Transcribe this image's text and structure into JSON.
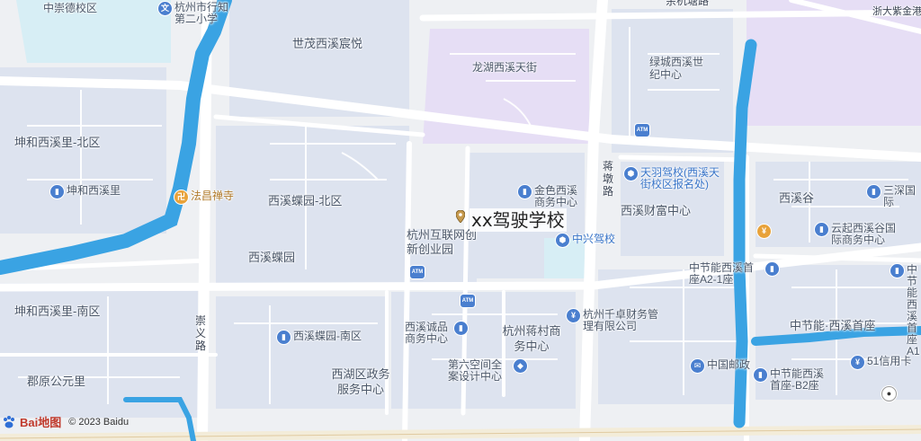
{
  "map": {
    "colors": {
      "land": "#eef0f3",
      "block": "#e2e8f2",
      "residential": "#dde3ef",
      "campus": "#e6def5",
      "water": "#3aa3e3",
      "road": "#ffffff",
      "arterial": "#f3ecd9",
      "tint": "#d7eef5"
    },
    "road_names": {
      "left_vertical": "崇义路",
      "center_vertical": "蒋墩路",
      "top_road": "余杭塘路",
      "top_right": "浙大紫金港"
    },
    "area_labels": [
      "中崇德校区",
      "世茂西溪宸悦",
      "龙湖西溪天街",
      "绿城西溪世纪中心",
      "坤和西溪里-北区",
      "西溪蝶园-北区",
      "西溪蝶园",
      "西溪财富中心",
      "西溪谷",
      "坤和西溪里-南区",
      "西湖区政务服务中心",
      "杭州蒋村商务中心",
      "中节能·西溪首座",
      "郡原公元里",
      "杭州互联网创新创业园"
    ],
    "pois": [
      {
        "name": "杭州市行知第二小学",
        "icon": "school-icon"
      },
      {
        "name": "坤和西溪里",
        "icon": "building-icon"
      },
      {
        "name": "法昌禅寺",
        "icon": "temple-icon"
      },
      {
        "name": "金色西溪商务中心",
        "icon": "building-icon"
      },
      {
        "name": "天羽驾校(西溪天街校区报名处)",
        "icon": "location-icon"
      },
      {
        "name": "中兴驾校",
        "icon": "location-icon"
      },
      {
        "name": "三深国际",
        "icon": "building-icon"
      },
      {
        "name": "云起西溪谷国际商务中心",
        "icon": "building-icon"
      },
      {
        "name": "中节能西溪首座A2-1座",
        "icon": "building-icon"
      },
      {
        "name": "中节能西溪首座A1",
        "icon": "building-icon"
      },
      {
        "name": "西溪蝶园-南区",
        "icon": "building-icon"
      },
      {
        "name": "西溪诚品商务中心",
        "icon": "building-icon"
      },
      {
        "name": "杭州千卓财务管理有限公司",
        "icon": "company-icon"
      },
      {
        "name": "第六空间全案设计中心",
        "icon": "shop-icon"
      },
      {
        "name": "中国邮政",
        "icon": "post-icon"
      },
      {
        "name": "51信用卡",
        "icon": "company-icon"
      },
      {
        "name": "中节能西溪首座-B2座",
        "icon": "building-icon"
      }
    ],
    "atm_label": "ATM",
    "marker": {
      "label": "xx驾驶学校"
    },
    "footer": {
      "logo": "Bai地图",
      "copyright": "© 2023 Baidu"
    }
  }
}
